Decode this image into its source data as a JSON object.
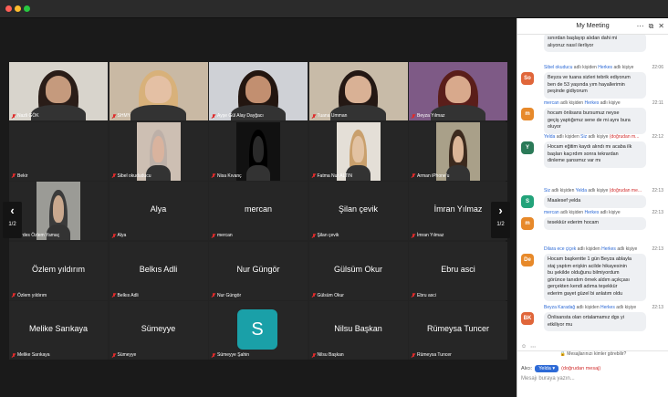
{
  "window": {
    "traffic_lights": [
      "#ff5f57",
      "#febc2e",
      "#28c840"
    ]
  },
  "gallery": {
    "page_indicator_left": "1/2",
    "page_indicator_right": "1/2",
    "tiles": [
      {
        "name": "Nazli GÖK",
        "video": true,
        "bg": "#d8d4cc",
        "skin": "#c59a7d",
        "hair": "#2a1d18"
      },
      {
        "name": "SHMY",
        "video": true,
        "bg": "#c9b9a4",
        "skin": "#e4c0a4",
        "hair": "#d8b17a",
        "active": true
      },
      {
        "name": "Ayşe Gül Alay Dayğacı",
        "video": true,
        "bg": "#cfd1d6",
        "skin": "#c28f70",
        "hair": "#231610"
      },
      {
        "name": "Tuana Umman",
        "video": true,
        "bg": "#c8bba8",
        "skin": "#d9b195",
        "hair": "#241814"
      },
      {
        "name": "Beyza Yılmaz",
        "video": true,
        "bg": "#7e5a86",
        "skin": "#d8a98c",
        "hair": "#5a1e1a"
      },
      {
        "name": "Bekir",
        "video": false
      },
      {
        "name": "Sibel okududucu",
        "video": true,
        "bg": "#cdbfb3",
        "skin": "#d9b39e",
        "hair": "#bdb0a8",
        "partial": true
      },
      {
        "name": "Nisa Kıvanç",
        "video": true,
        "bg": "#111111",
        "skin": "#2a2a2a",
        "hair": "#000000",
        "partial": true
      },
      {
        "name": "Fatma Nur ALTIN",
        "video": true,
        "bg": "#e4dfd7",
        "skin": "#e2c2a2",
        "hair": "#c9a06d",
        "partial": true
      },
      {
        "name": "Arman iPhone'u",
        "video": true,
        "bg": "#a9a089",
        "skin": "#dbb597",
        "hair": "#3c2a1e",
        "partial": true
      },
      {
        "name": "Firdes Özlem Yamaç",
        "video": true,
        "bg": "#9b9b96",
        "skin": "#c9a88e",
        "hair": "#3b3b3b",
        "partial": true
      },
      {
        "name": "Alya",
        "display": "Alya",
        "video": false
      },
      {
        "name": "mercan",
        "display": "mercan",
        "video": false
      },
      {
        "name": "Şilan çevik",
        "display": "Şilan çevik",
        "video": false
      },
      {
        "name": "İmran Yılmaz",
        "display": "İmran Yılmaz",
        "video": false
      },
      {
        "name": "Özlem yıldırım",
        "display": "Özlem yıldırım",
        "video": false
      },
      {
        "name": "Belkıs Adli",
        "display": "Belkıs Adli",
        "video": false
      },
      {
        "name": "Nur Güngör",
        "display": "Nur Güngör",
        "video": false
      },
      {
        "name": "Gülsüm Okur",
        "display": "Gülsüm Okur",
        "video": false
      },
      {
        "name": "Ebru asci",
        "display": "Ebru asci",
        "video": false
      },
      {
        "name": "Melike Sarıkaya",
        "display": "Melike Sarıkaya",
        "video": false
      },
      {
        "name": "Sümeyye",
        "display": "Sümeyye",
        "video": false
      },
      {
        "name": "Sümeyye Şahin",
        "avatar_letter": "S",
        "avatar_color": "#1aa0a8",
        "video": false
      },
      {
        "name": "Nilsu Başkan",
        "display": "Nilsu Başkan",
        "video": false
      },
      {
        "name": "Rümeysa Tuncer",
        "display": "Rümeysa Tuncer",
        "video": false
      }
    ]
  },
  "chat": {
    "title": "My Meeting",
    "header_icons": [
      "more-icon",
      "popout-icon",
      "close-icon"
    ],
    "messages": [
      {
        "partial_text": "sınırdan başlayıp alıdan dahi mi\nalıyoruz nasıl ilerliyor"
      },
      {
        "initials": "So",
        "color": "#e0663a",
        "from": "Sibel okuducu",
        "mid": " adlı kişiden ",
        "to": "Herkes",
        "tail": " adlı kişiye",
        "dm": "",
        "time": "22:06",
        "text": "Beyza ve tuana sizleri tebrik ediyorum\nben de 53 yaşında yım hayallerimin\npeşinde gidiyorum"
      },
      {
        "initials": "m",
        "color": "#e7892a",
        "from": "mercan",
        "mid": " adlı kişiden ",
        "to": "Herkes",
        "tail": " adlı kişiye",
        "dm": "",
        "time": "22:11",
        "text": "hocam önlisans bursumuz neyse\ngeçiş yaptığımız sene de mi aynı bura\noluyor"
      },
      {
        "initials": "Y",
        "color": "#2b7a58",
        "from": "Yelda",
        "mid": " adlı kişiden ",
        "to": "Siz",
        "tail": " adlı kişiye ",
        "dm": "(doğrudan m...",
        "time": "22:12",
        "text": "Hocam eğitim kaydı alındı mı acaba ilk\nbaşları kaçırdım sonra tekrardan\ndinleme şansımız var mı"
      },
      {
        "initials": "S",
        "color": "#23a37a",
        "from": "Siz",
        "mid": " adlı kişiden ",
        "to": "Yelda",
        "tail": " adlı kişiye ",
        "dm": "(doğrudan me...",
        "time": "22:13",
        "text": "Maalesef yelda"
      },
      {
        "initials": "m",
        "color": "#e7892a",
        "from": "mercan",
        "mid": " adlı kişiden ",
        "to": "Herkes",
        "tail": " adlı kişiye",
        "dm": "",
        "time": "22:13",
        "text": "tesekkür ederim hocam"
      },
      {
        "initials": "De",
        "color": "#e7892a",
        "from": "Dilara ece çiçek",
        "mid": " adlı kişiden ",
        "to": "Herkes",
        "tail": " adlı kişiye",
        "dm": "",
        "time": "22:13",
        "text": "Hocam başkentte 1 gün Beyza ablayla\nstaj yaptım  erişkin acilde hikayesinin\nbu şekilde olduğunu bilmiyordum\ngörünce tanıdım örnek aldım açıkçası\ngerçekten kendi adıma teşekkür\nederim gayet güzel bi anlatım oldu"
      },
      {
        "initials": "BK",
        "color": "#e0663a",
        "from": "Beyza Karadağ",
        "mid": " adlı kişiden ",
        "to": "Herkes",
        "tail": " adlı kişiye",
        "dm": "",
        "time": "22:13",
        "text": "Önlisansta olan ortalamamız dgs yi\netkiliyor mu"
      }
    ],
    "who_can_see": "Mesajlarınızı kimler görebilir?",
    "to_label": "Alıcı:",
    "to_value": "Yelda ▾",
    "dm_note": "(doğrudan mesaj)",
    "placeholder": "Mesajı buraya yazın..."
  }
}
